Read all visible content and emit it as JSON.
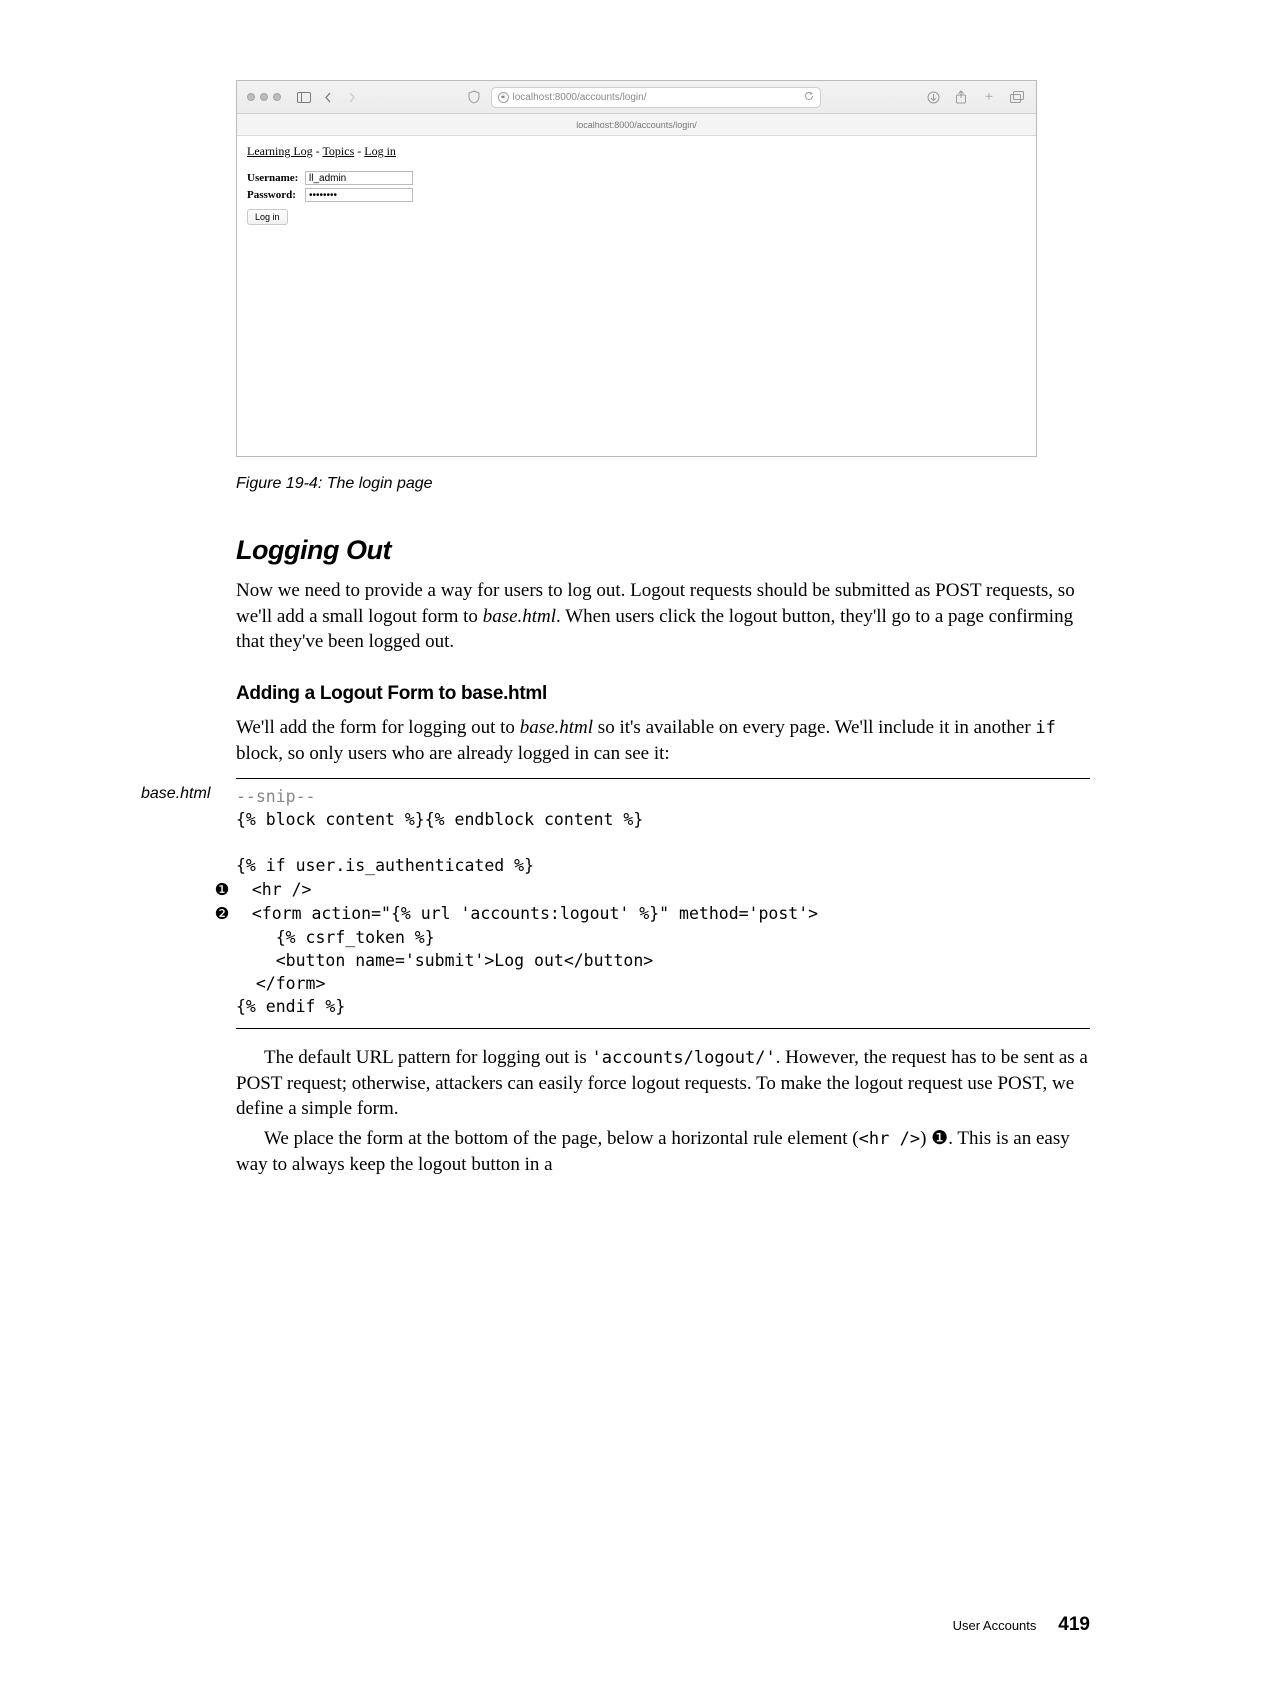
{
  "browser": {
    "url": "localhost:8000/accounts/login/",
    "tab": "localhost:8000/accounts/login/",
    "nav": {
      "link1": "Learning Log",
      "sep1": " - ",
      "link2": "Topics",
      "sep2": " - ",
      "link3": "Log in"
    },
    "form": {
      "username_label": "Username:",
      "username_value": "ll_admin",
      "password_label": "Password:",
      "password_value": "••••••••",
      "button": "Log in"
    }
  },
  "figure_caption": "Figure 19-4: The login page",
  "heading_logging_out": "Logging Out",
  "para1_a": "Now we need to provide a way for users to log out. Logout requests should be submitted as POST requests, so we'll add a small logout form to ",
  "para1_fname": "base.html",
  "para1_b": ". When users click the logout button, they'll go to a page confirming that they've been logged out.",
  "heading_adding": "Adding a Logout Form to base.html",
  "para2_a": "We'll add the form for logging out to ",
  "para2_fname": "base.html",
  "para2_b": " so it's available on every page. We'll include it in another ",
  "para2_code": "if",
  "para2_c": " block, so only users who are already logged in can see it:",
  "code_label": "base.html",
  "code": {
    "l1": "--snip--",
    "l2": "{% block content %}{% endblock content %}",
    "l3": "",
    "l4": "{% if user.is_authenticated %}",
    "b1": "❶",
    "l5": "  <hr />",
    "b2": "❷",
    "l6": "  <form action=\"{% url 'accounts:logout' %}\" method='post'>",
    "l7": "    {% csrf_token %}",
    "l8": "    <button name='submit'>Log out</button>",
    "l9": "  </form>",
    "l10": "{% endif %}"
  },
  "para3_a": "The default URL pattern for logging out is ",
  "para3_code1": "'accounts/logout/'",
  "para3_b": ". However, the request has to be sent as a POST request; otherwise, attackers can easily force logout requests. To make the logout request use POST, we define a simple form.",
  "para4_a": "We place the form at the bottom of the page, below a horizontal rule element (",
  "para4_code": "<hr />",
  "para4_b": ") ",
  "para4_bullet": "❶",
  "para4_c": ". This is an easy way to always keep the logout button in a",
  "footer": {
    "chapter": "User Accounts",
    "page": "419"
  }
}
